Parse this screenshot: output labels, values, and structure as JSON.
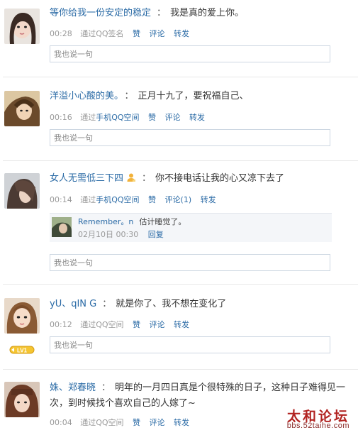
{
  "posts": [
    {
      "author": "等你给我一份安定的稳定",
      "colon": "：",
      "content": "我是真的爱上你。",
      "time": "00:28",
      "source_prefix": "通过",
      "source": "QQ签名",
      "source_is_link": false,
      "like": "赞",
      "comment": "评论",
      "share": "转发",
      "reply_placeholder": "我也说一句"
    },
    {
      "author": "洋溢小心酸的美。",
      "colon": "：",
      "content": "正月十九了，要祝福自己、",
      "time": "00:16",
      "source_prefix": "通过",
      "source": "手机QQ空间",
      "source_is_link": true,
      "like": "赞",
      "comment": "评论",
      "share": "转发",
      "reply_placeholder": "我也说一句"
    },
    {
      "author": "女人无需低三下四",
      "colon": "：",
      "content": "你不接电话让我的心又凉下去了",
      "time": "00:14",
      "source_prefix": "通过",
      "source": "手机QQ空间",
      "source_is_link": true,
      "like": "赞",
      "comment": "评论(1)",
      "share": "转发",
      "reply_placeholder": "我也说一句",
      "reply": {
        "name": "Remember。n",
        "text": "估计睡觉了。",
        "time": "02月10日 00:30",
        "action": "回复"
      }
    },
    {
      "author": "yU、qIN G",
      "colon": "：",
      "content": "就是你了、我不想在变化了",
      "time": "00:12",
      "source_prefix": "通过",
      "source": "QQ空间",
      "source_is_link": false,
      "like": "赞",
      "comment": "评论",
      "share": "转发",
      "reply_placeholder": "我也说一句",
      "badge": "LV1"
    },
    {
      "author": "姝、郑春晓",
      "colon": "：",
      "content": "明年的一月四日真是个很特殊的日子，这种日子难得见一次，到时候找个喜欢自己的人嫁了~",
      "time": "00:04",
      "source_prefix": "通过",
      "source": "QQ空间",
      "source_is_link": false,
      "like": "赞",
      "comment": "评论",
      "share": "转发"
    }
  ],
  "watermark": {
    "title": "太和论坛",
    "url": "bbs.52taihe.com"
  },
  "colors": {
    "link": "#2b6ba6",
    "meta": "#999999",
    "watermark": "#b22422"
  }
}
